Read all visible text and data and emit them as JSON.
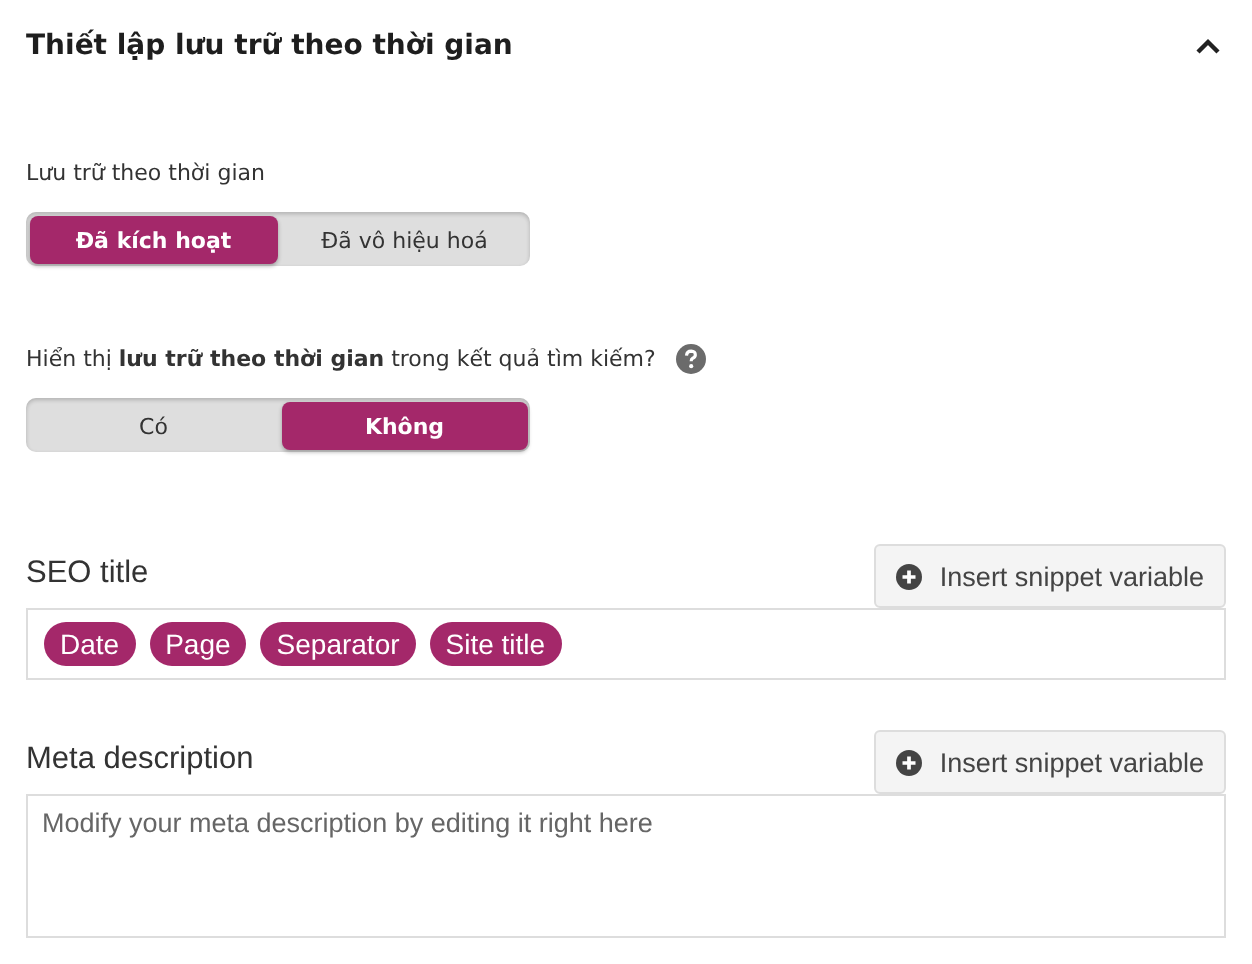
{
  "section": {
    "title": "Thiết lập lưu trữ theo thời gian",
    "expanded": true
  },
  "settings": [
    {
      "label": "Lưu trữ theo thời gian",
      "help": false,
      "options": [
        {
          "label": "Đã kích hoạt",
          "selected": true
        },
        {
          "label": "Đã vô hiệu hoá",
          "selected": false
        }
      ]
    },
    {
      "label": "Hiển thị **lưu trữ theo thời gian** trong kết quả tìm kiếm?",
      "help": true,
      "options": [
        {
          "label": "Có",
          "selected": false
        },
        {
          "label": "Không",
          "selected": true
        }
      ]
    }
  ],
  "seo_title": {
    "label": "SEO title",
    "button": "Insert snippet variable",
    "tags": [
      "Date",
      "Page",
      "Separator",
      "Site title"
    ]
  },
  "meta_description": {
    "label": "Meta description",
    "button": "Insert snippet variable",
    "placeholder": "Modify your meta description by editing it right here"
  }
}
